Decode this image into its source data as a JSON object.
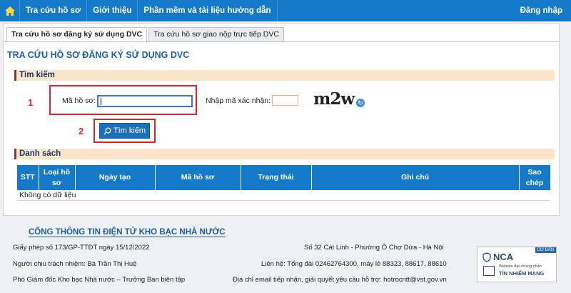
{
  "nav": {
    "items": [
      "Tra cứu hồ sơ",
      "Giới thiệu",
      "Phần mềm và tài liệu hướng dẫn"
    ],
    "login": "Đăng nhập"
  },
  "tabs": [
    "Tra cứu hồ sơ đăng ký sử dụng DVC",
    "Tra cứu hồ sơ giao nộp trực tiếp DVC"
  ],
  "page_title": "TRA CỨU HỒ SƠ ĐĂNG KÝ SỬ DỤNG DVC",
  "search": {
    "section": "Tìm kiếm",
    "code_label": "Mã hồ sơ:",
    "code_value": "",
    "captcha_label": "Nhập mã xác nhận:",
    "captcha_value": "",
    "captcha_text": "m2w",
    "button": "Tìm kiếm",
    "marker1": "1",
    "marker2": "2"
  },
  "list": {
    "section": "Danh sách",
    "columns": [
      "STT",
      "Loại hồ sơ",
      "Ngày tạo",
      "Mã hồ sơ",
      "Trạng thái",
      "Ghi chú",
      "Sao chép"
    ],
    "empty": "Không có dữ liệu"
  },
  "footer": {
    "title": "CỔNG THÔNG TIN ĐIỆN TỬ KHO BẠC NHÀ NƯỚC",
    "license": "Giấy phép số 173/GP-TTĐT ngày 15/12/2022",
    "responsible": "Người chịu trách nhiệm: Bà Trần Thị Huệ",
    "position": "Phó Giám đốc Kho bạc Nhà nước – Trưởng Ban biên tập",
    "address": "Số 32 Cát Linh - Phường Ô Chợ Dừa - Hà Nội",
    "contact": "Liên hệ: Tổng đài 02462764300, máy lẻ 88323, 88617, 88610",
    "email": "Địa chỉ email tiếp nhận, giải quyết yêu cầu hỗ trợ: hotrocntt@vst.gov.vn",
    "badge": {
      "tag": "CƠ BẢN",
      "logo": "NCA",
      "line1": "Website đạt chứng nhận",
      "line2": "TÍN NHIỆM MẠNG"
    }
  },
  "colors": {
    "primary": "#1479c9",
    "section": "#fbe5c8",
    "highlight": "#d9252b"
  }
}
